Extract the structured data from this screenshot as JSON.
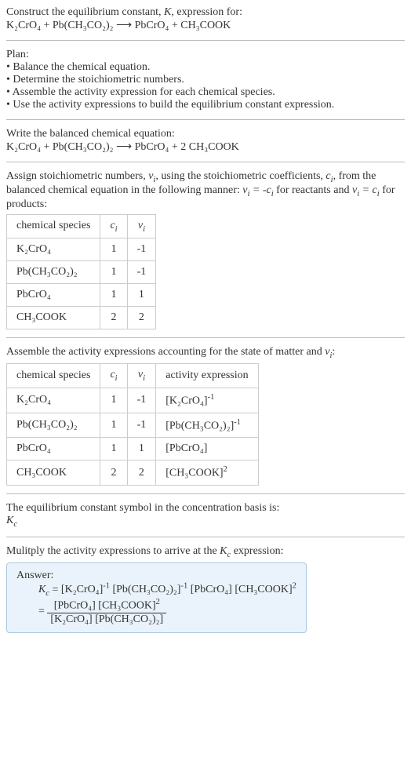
{
  "intro": {
    "line1_a": "Construct the equilibrium constant, ",
    "line1_b": ", expression for:",
    "eq1": "K₂CrO₄ + Pb(CH₃CO₂)₂ ⟶ PbCrO₄ + CH₃COOK"
  },
  "plan": {
    "title": "Plan:",
    "b1": "• Balance the chemical equation.",
    "b2": "• Determine the stoichiometric numbers.",
    "b3": "• Assemble the activity expression for each chemical species.",
    "b4": "• Use the activity expressions to build the equilibrium constant expression."
  },
  "balanced": {
    "title": "Write the balanced chemical equation:",
    "eq": "K₂CrO₄ + Pb(CH₃CO₂)₂ ⟶ PbCrO₄ + 2 CH₃COOK"
  },
  "stoich": {
    "p1": "Assign stoichiometric numbers, ",
    "p2": ", using the stoichiometric coefficients, ",
    "p3": ", from the balanced chemical equation in the following manner: ",
    "p4": " for reactants and ",
    "p5": " for products:"
  },
  "table1": {
    "h1": "chemical species",
    "h2": "cᵢ",
    "h3": "νᵢ",
    "r1": {
      "s": "K₂CrO₄",
      "c": "1",
      "v": "-1"
    },
    "r2": {
      "s": "Pb(CH₃CO₂)₂",
      "c": "1",
      "v": "-1"
    },
    "r3": {
      "s": "PbCrO₄",
      "c": "1",
      "v": "1"
    },
    "r4": {
      "s": "CH₃COOK",
      "c": "2",
      "v": "2"
    }
  },
  "assemble": {
    "p1": "Assemble the activity expressions accounting for the state of matter and ",
    "p2": ":"
  },
  "table2": {
    "h1": "chemical species",
    "h2": "cᵢ",
    "h3": "νᵢ",
    "h4": "activity expression",
    "r1": {
      "s": "K₂CrO₄",
      "c": "1",
      "v": "-1",
      "a_base": "[K₂CrO₄]",
      "a_exp": "-1"
    },
    "r2": {
      "s": "Pb(CH₃CO₂)₂",
      "c": "1",
      "v": "-1",
      "a_base": "[Pb(CH₃CO₂)₂]",
      "a_exp": "-1"
    },
    "r3": {
      "s": "PbCrO₄",
      "c": "1",
      "v": "1",
      "a_base": "[PbCrO₄]",
      "a_exp": ""
    },
    "r4": {
      "s": "CH₃COOK",
      "c": "2",
      "v": "2",
      "a_base": "[CH₃COOK]",
      "a_exp": "2"
    }
  },
  "symbol": {
    "line": "The equilibrium constant symbol in the concentration basis is:",
    "kc": "K",
    "kc_sub": "c"
  },
  "multiply": {
    "p1": "Mulitply the activity expressions to arrive at the ",
    "p2": " expression:"
  },
  "answer": {
    "title": "Answer:",
    "lhs_k": "K",
    "lhs_c": "c",
    "eq": " = ",
    "t1": "[K₂CrO₄]",
    "t1e": "-1",
    "t2": " [Pb(CH₃CO₂)₂]",
    "t2e": "-1",
    "t3": " [PbCrO₄] [CH₃COOK]",
    "t3e": "2",
    "eq2": "= ",
    "num": "[PbCrO₄] [CH₃COOK]",
    "num_e": "2",
    "den": "[K₂CrO₄] [Pb(CH₃CO₂)₂]"
  }
}
